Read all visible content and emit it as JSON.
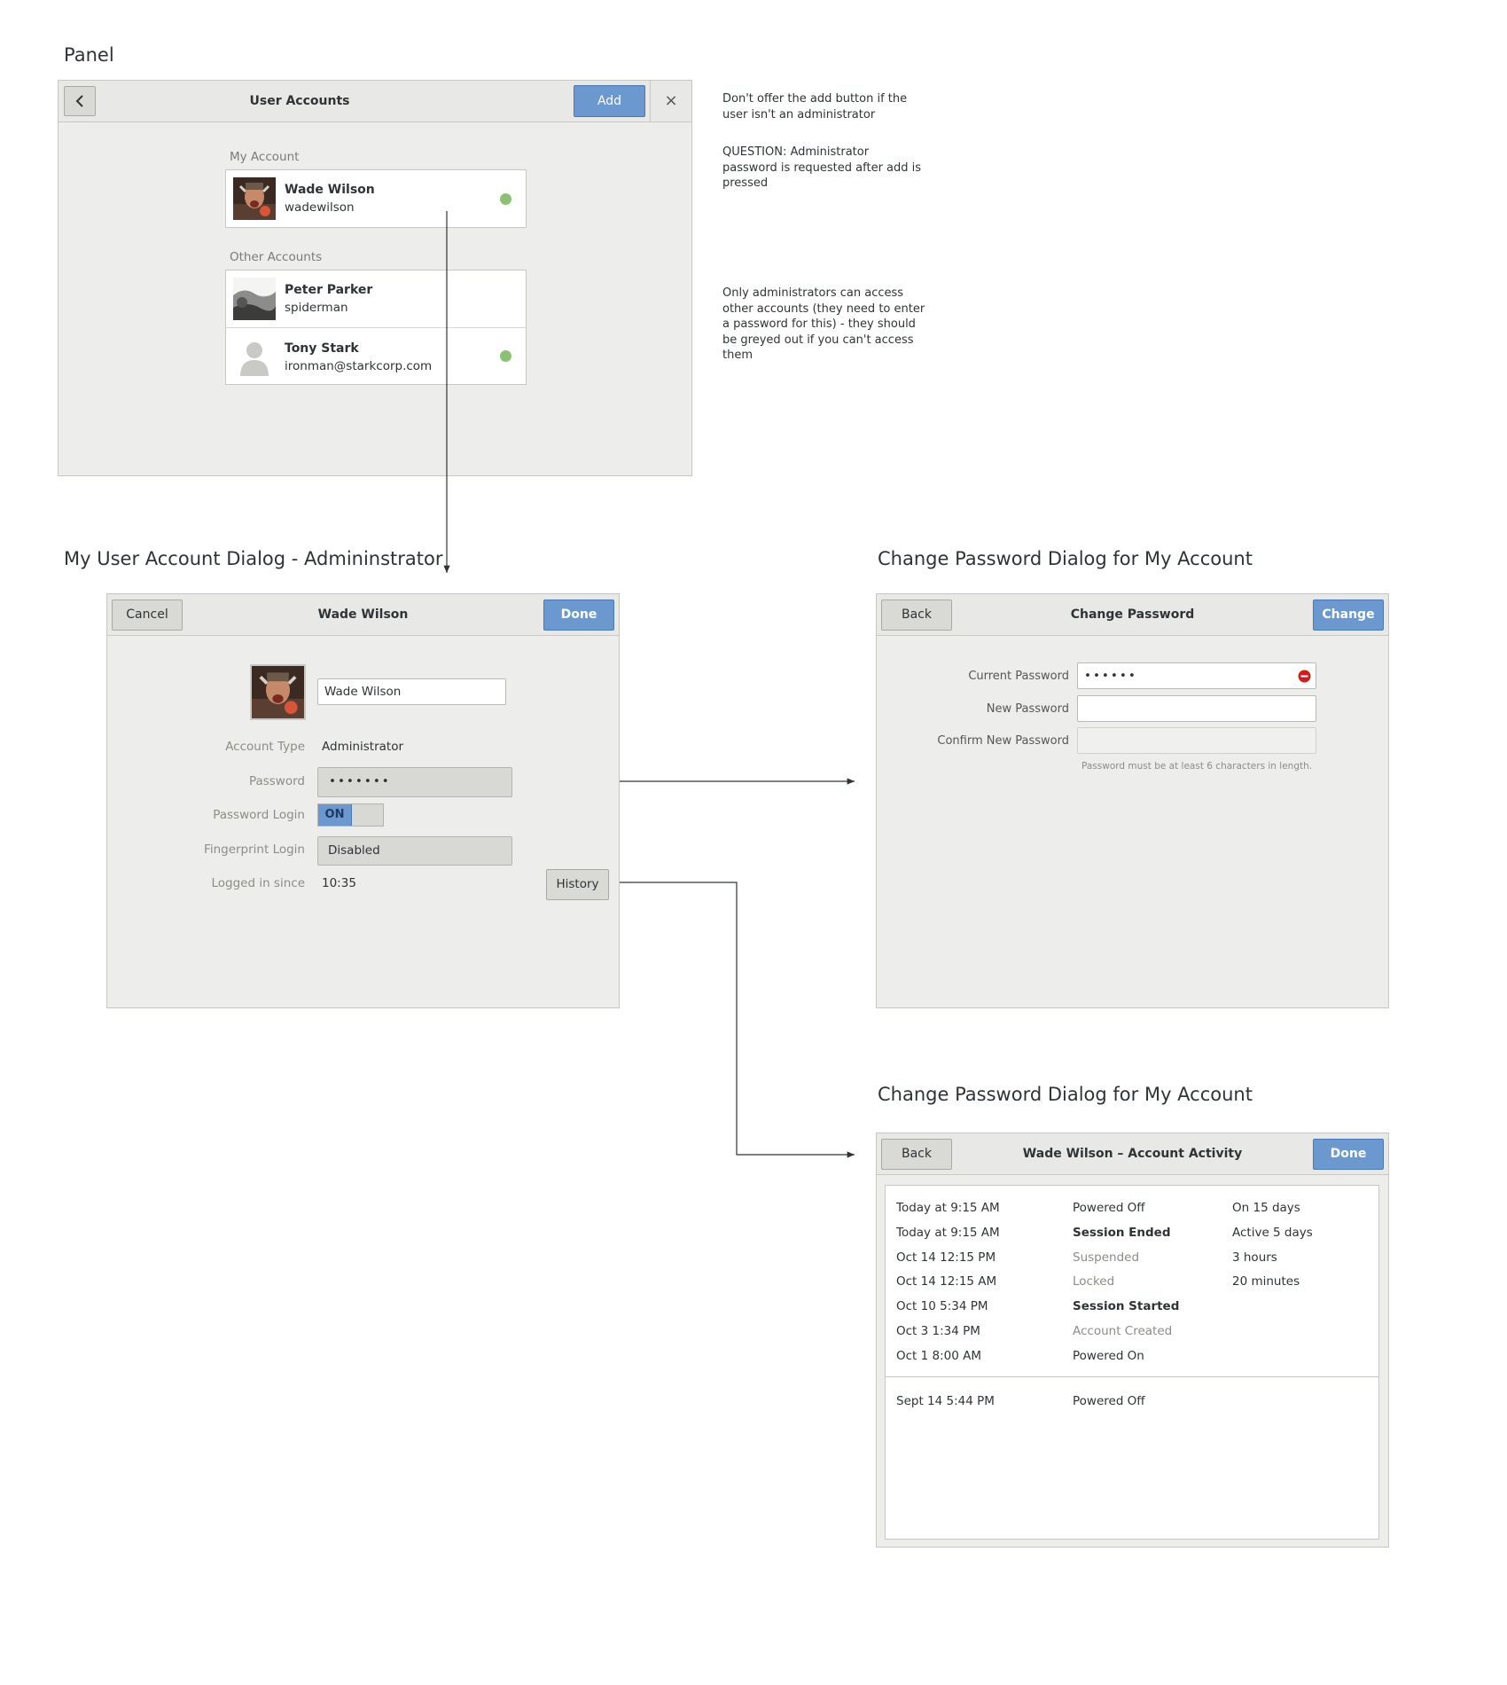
{
  "titles": {
    "panel": "Panel",
    "account_dialog": "My User Account Dialog - Admininstrator",
    "change_password": "Change Password Dialog for My Account",
    "activity": "Change Password Dialog for My Account"
  },
  "notes": {
    "add_button": "Don't offer the add button if the user isn't an administrator",
    "question": "QUESTION: Administrator password is requested after add is pressed",
    "other_accounts": "Only administrators can access other accounts (they need to enter a password for this) - they should be greyed out if you can't access them"
  },
  "panel": {
    "title": "User Accounts",
    "add_label": "Add",
    "close_glyph": "×",
    "back_icon": "chevron-left-icon",
    "my_account_label": "My Account",
    "other_accounts_label": "Other Accounts",
    "my_account": {
      "name": "Wade Wilson",
      "username": "wadewilson",
      "online": true
    },
    "others": [
      {
        "name": "Peter Parker",
        "username": "spiderman",
        "online": false
      },
      {
        "name": "Tony Stark",
        "username": "ironman@starkcorp.com",
        "online": true
      }
    ]
  },
  "account_dialog": {
    "title": "Wade Wilson",
    "cancel_label": "Cancel",
    "done_label": "Done",
    "name_value": "Wade Wilson",
    "account_type_label": "Account Type",
    "account_type_value": "Administrator",
    "password_label": "Password",
    "password_value": "•••••••",
    "password_login_label": "Password Login",
    "password_login_state": "ON",
    "fingerprint_label": "Fingerprint Login",
    "fingerprint_value": "Disabled",
    "logged_in_label": "Logged in since",
    "logged_in_value": "10:35",
    "history_label": "History"
  },
  "change_password": {
    "title": "Change Password",
    "back_label": "Back",
    "change_label": "Change",
    "current_label": "Current Password",
    "current_value": "••••••",
    "new_label": "New Password",
    "new_value": "",
    "confirm_label": "Confirm New Password",
    "confirm_value": "",
    "hint": "Password must be at least 6 characters in length."
  },
  "activity": {
    "title": "Wade Wilson – Account Activity",
    "back_label": "Back",
    "done_label": "Done",
    "rows": [
      {
        "time": "Today at 9:15 AM",
        "event": "Powered Off",
        "style": "normal",
        "duration": "On 15 days"
      },
      {
        "time": "Today at 9:15 AM",
        "event": "Session Ended",
        "style": "bold",
        "duration": "Active 5 days"
      },
      {
        "time": "Oct 14 12:15 PM",
        "event": "Suspended",
        "style": "dim",
        "duration": "3 hours"
      },
      {
        "time": "Oct 14 12:15 AM",
        "event": "Locked",
        "style": "dim",
        "duration": "20 minutes"
      },
      {
        "time": "Oct 10 5:34 PM",
        "event": "Session Started",
        "style": "bold",
        "duration": ""
      },
      {
        "time": "Oct 3 1:34 PM",
        "event": "Account Created",
        "style": "dim",
        "duration": ""
      },
      {
        "time": "Oct 1 8:00 AM",
        "event": "Powered On",
        "style": "normal",
        "duration": ""
      }
    ],
    "older_rows": [
      {
        "time": "Sept 14 5:44 PM",
        "event": "Powered Off",
        "style": "normal",
        "duration": ""
      }
    ]
  },
  "colors": {
    "accent_blue": "#6c98d0",
    "online_green": "#8cc172",
    "error_red": "#cc1f1f",
    "window_bg": "#ededeb"
  }
}
